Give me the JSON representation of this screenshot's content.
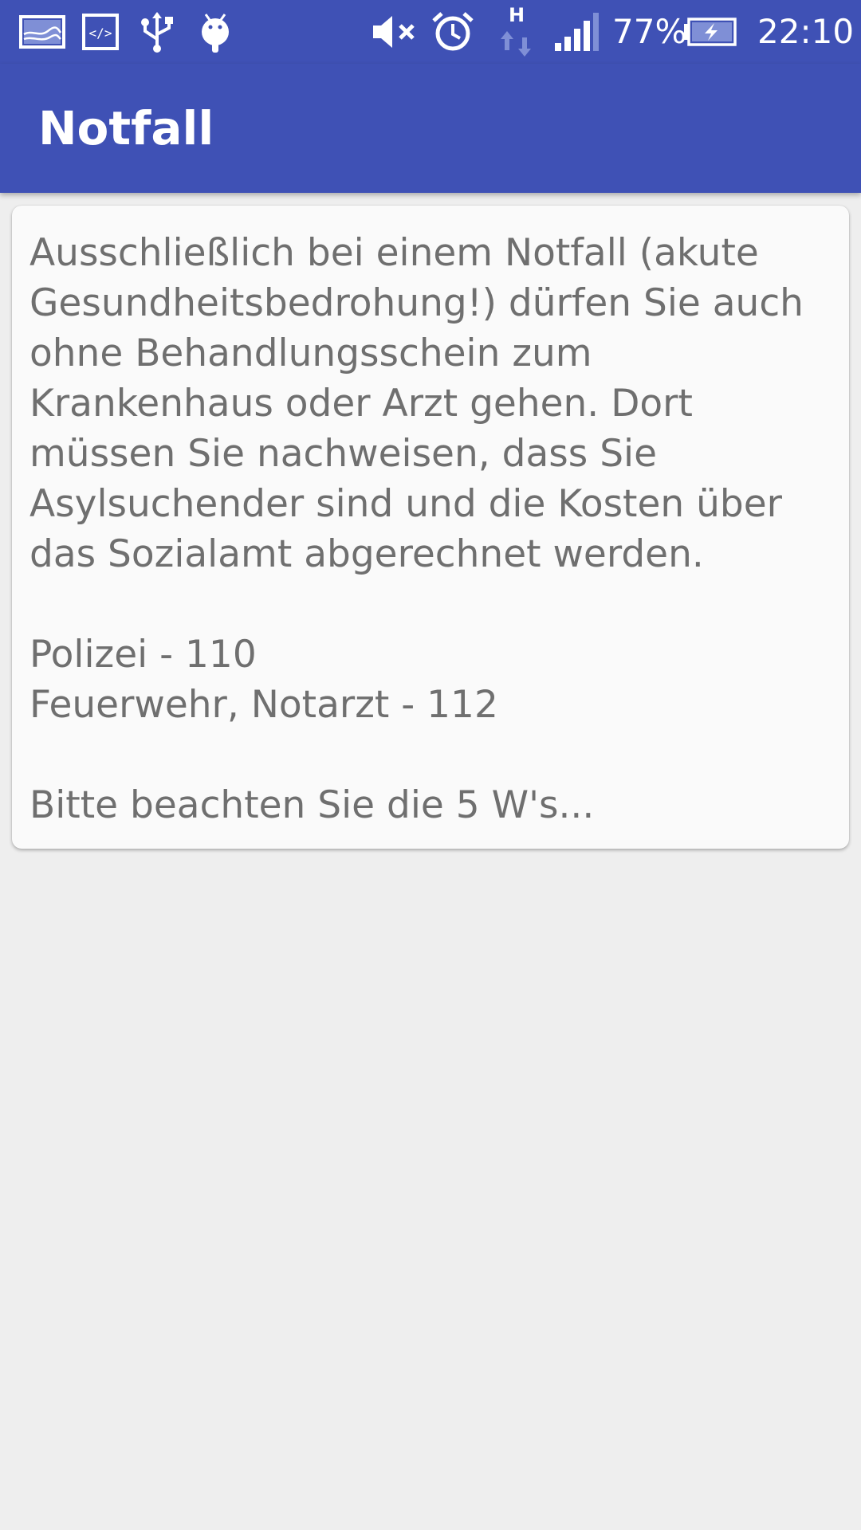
{
  "status_bar": {
    "battery_percent": "77%",
    "time": "22:10",
    "network_type": "H",
    "icons": [
      "gallery-icon",
      "code-icon",
      "usb-icon",
      "android-debug-icon",
      "mute-icon",
      "alarm-icon",
      "data-transfer-icon",
      "signal-icon",
      "battery-charging-icon"
    ],
    "colors": {
      "background": "#3f51b5"
    }
  },
  "app_bar": {
    "title": "Notfall",
    "colors": {
      "background": "#3f51b5",
      "title": "#ffffff"
    }
  },
  "card": {
    "intro": "Ausschließlich bei einem Notfall (akute Gesundheitsbedrohung!) dürfen Sie auch ohne Behandlungsschein zum Krankenhaus oder Arzt gehen. Dort müssen Sie nachweisen, dass Sie Asylsuchender sind und die Kosten über das Sozialamt abgerechnet werden.",
    "numbers": [
      "Polizei - 110",
      "Feuerwehr, Notarzt - 112"
    ],
    "note": "Bitte beachten Sie die 5 W's...",
    "colors": {
      "background": "#fafafa",
      "text": "#6f6f6f"
    }
  },
  "page": {
    "background": "#eeeeee"
  }
}
